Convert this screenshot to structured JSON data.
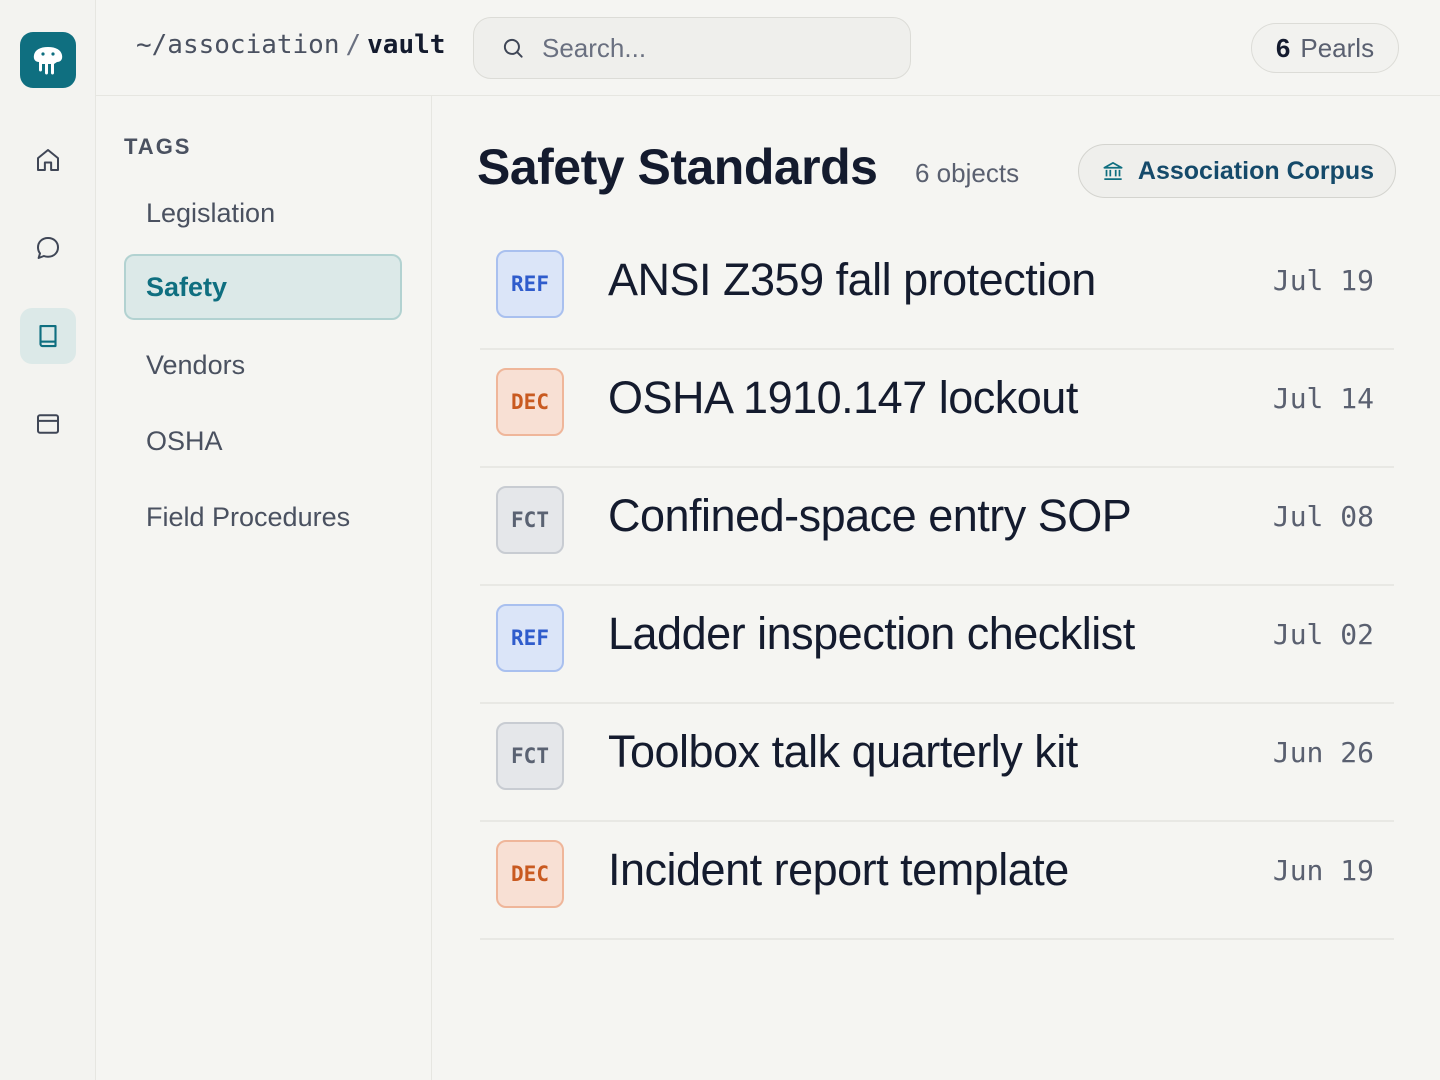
{
  "rail": {
    "logo": "elephant-logo-icon",
    "items": [
      {
        "name": "home",
        "icon": "home-icon",
        "active": false
      },
      {
        "name": "chat",
        "icon": "chat-bubble-icon",
        "active": false
      },
      {
        "name": "vault",
        "icon": "book-icon",
        "active": true
      },
      {
        "name": "window",
        "icon": "window-icon",
        "active": false
      }
    ]
  },
  "header": {
    "breadcrumb_root": "~/association",
    "breadcrumb_sep": "/",
    "breadcrumb_current": "vault",
    "search_placeholder": "Search...",
    "pearls_count": "6",
    "pearls_label": "Pearls"
  },
  "tags": {
    "title": "TAGS",
    "items": [
      {
        "label": "Legislation",
        "active": false
      },
      {
        "label": "Safety",
        "active": true
      },
      {
        "label": "Vendors",
        "active": false
      },
      {
        "label": "OSHA",
        "active": false
      },
      {
        "label": "Field Procedures",
        "active": false
      }
    ]
  },
  "main": {
    "title": "Safety Standards",
    "count": "6 objects",
    "corpus_label": "Association Corpus",
    "corpus_icon": "bank-icon",
    "rows": [
      {
        "badge": "REF",
        "title": "ANSI Z359 fall protection",
        "date": "Jul 19"
      },
      {
        "badge": "DEC",
        "title": "OSHA 1910.147 lockout",
        "date": "Jul 14"
      },
      {
        "badge": "FCT",
        "title": "Confined-space entry SOP",
        "date": "Jul 08"
      },
      {
        "badge": "REF",
        "title": "Ladder inspection checklist",
        "date": "Jul 02"
      },
      {
        "badge": "FCT",
        "title": "Toolbox talk quarterly kit",
        "date": "Jun 26"
      },
      {
        "badge": "DEC",
        "title": "Incident report template",
        "date": "Jun 19"
      }
    ]
  },
  "colors": {
    "accent": "#0f6f80",
    "ref": "#2f5ccc",
    "dec": "#c95a20",
    "fct": "#5a6272"
  }
}
